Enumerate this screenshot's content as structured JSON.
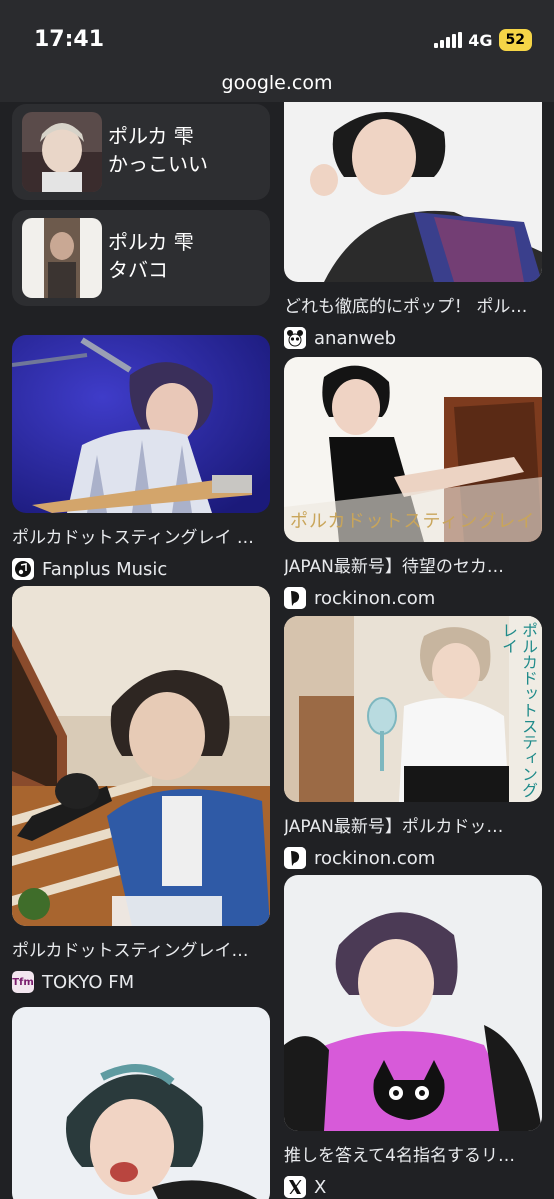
{
  "status_bar": {
    "time": "17:41",
    "network": "4G",
    "battery": "52"
  },
  "address_bar": {
    "url": "google.com"
  },
  "related_searches": [
    {
      "line1": "ポルカ 雫",
      "line2": "かっこいい"
    },
    {
      "line1": "ポルカ 雫",
      "line2": "タバコ"
    }
  ],
  "left_results": [
    {
      "title": "ポルカドットスティングレイ …",
      "source": "Fanplus Music",
      "source_icon": "music-note-icon"
    },
    {
      "title": "ポルカドットスティングレイ…",
      "source": "TOKYO FM",
      "source_icon_text": "Tfm"
    },
    {
      "title": "",
      "source": ""
    }
  ],
  "right_results": [
    {
      "title": "どれも徹底的にポップ！ ポル…",
      "source": "ananweb",
      "source_icon": "panda-icon"
    },
    {
      "title": "JAPAN最新号】待望のセカ…",
      "source": "rockinon.com",
      "source_icon": "rockinon-icon",
      "image_caption": "ポルカドットスティングレイ"
    },
    {
      "title": "JAPAN最新号】ポルカドッ…",
      "source": "rockinon.com",
      "source_icon": "rockinon-icon",
      "image_caption": "ポルカドットスティングレイ"
    },
    {
      "title": "推しを答えて4名指名するリ…",
      "source": "X",
      "source_icon": "x-logo-icon"
    }
  ],
  "colors": {
    "background": "#202124",
    "card": "#2d2e31",
    "battery": "#f5d547"
  }
}
